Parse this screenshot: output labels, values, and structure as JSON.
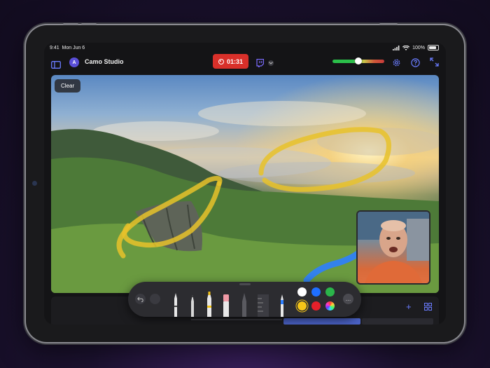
{
  "status_bar": {
    "time": "9:41",
    "date": "Mon Jun 6",
    "battery": "100%"
  },
  "toolbar": {
    "app_title": "Camo Studio",
    "avatar_letter": "A",
    "recording_time": "01:31",
    "audio_level": 0.5
  },
  "canvas": {
    "clear_label": "Clear"
  },
  "colors": {
    "record": "#d9302a",
    "accent": "#6a7cff",
    "swatches": [
      "#ffffff",
      "#1f6fff",
      "#2bb54a",
      "#f5c518",
      "#e5202a",
      "rainbow"
    ]
  },
  "palette": {
    "more_label": "…"
  }
}
